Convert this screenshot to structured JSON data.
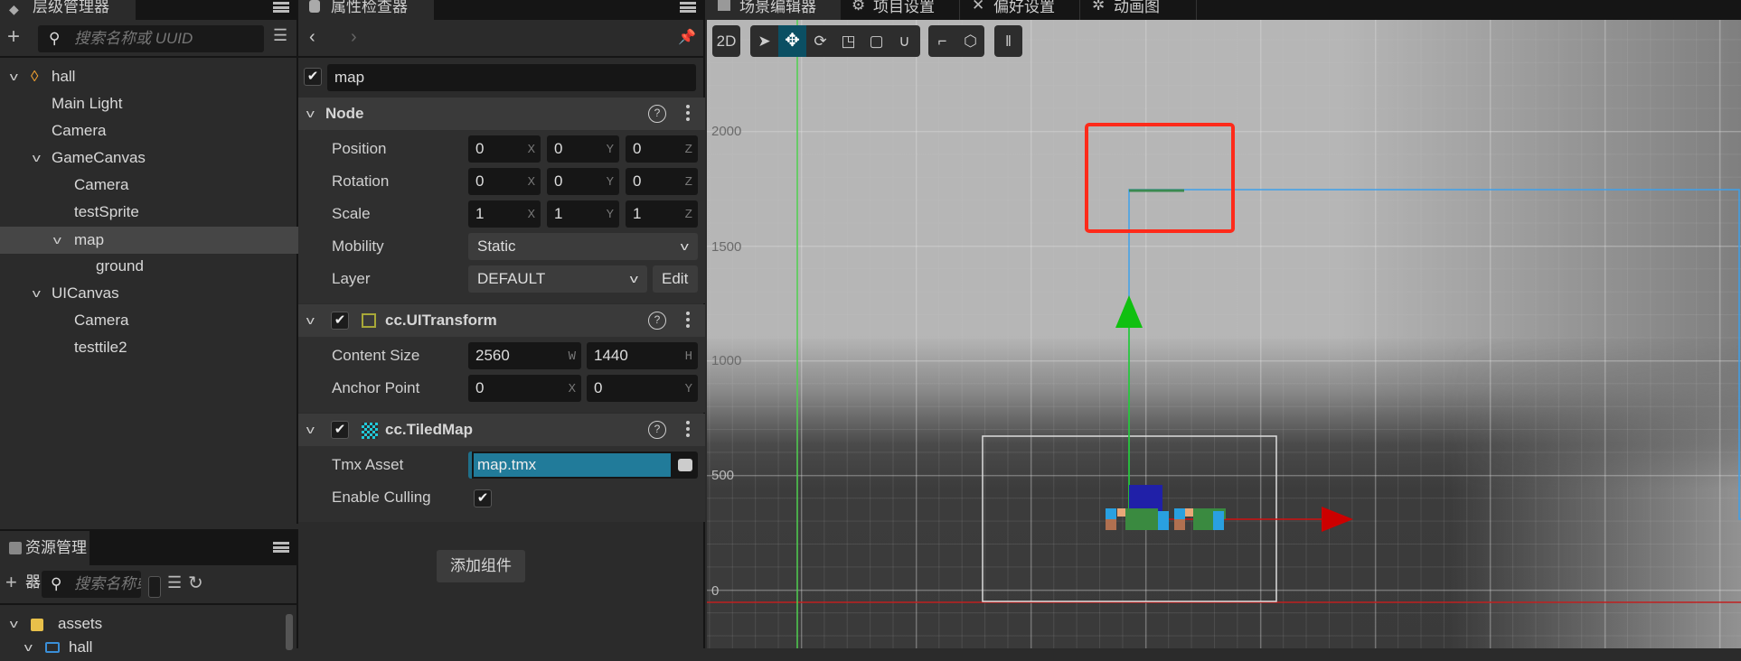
{
  "hierarchy": {
    "title": "层级管理器",
    "search_placeholder": "搜索名称或 UUID",
    "tree": [
      {
        "label": "hall"
      },
      {
        "label": "Main Light"
      },
      {
        "label": "Camera"
      },
      {
        "label": "GameCanvas"
      },
      {
        "label": "Camera"
      },
      {
        "label": "testSprite"
      },
      {
        "label": "map"
      },
      {
        "label": "ground"
      },
      {
        "label": "UICanvas"
      },
      {
        "label": "Camera"
      },
      {
        "label": "testtile2"
      }
    ]
  },
  "assets": {
    "title": "资源管理器",
    "search_placeholder": "搜索名称或 UU",
    "tree": [
      {
        "label": "assets"
      },
      {
        "label": "hall"
      }
    ]
  },
  "inspector": {
    "title": "属性检查器",
    "node_name": "map",
    "node_section": "Node",
    "props": {
      "position": {
        "label": "Position",
        "x": "0",
        "y": "0",
        "z": "0"
      },
      "rotation": {
        "label": "Rotation",
        "x": "0",
        "y": "0",
        "z": "0"
      },
      "scale": {
        "label": "Scale",
        "x": "1",
        "y": "1",
        "z": "1"
      },
      "mobility": {
        "label": "Mobility",
        "value": "Static"
      },
      "layer": {
        "label": "Layer",
        "value": "DEFAULT",
        "edit": "Edit"
      }
    },
    "axes": {
      "x": "X",
      "y": "Y",
      "z": "Z",
      "w": "W",
      "h": "H"
    },
    "uitransform": {
      "title": "cc.UITransform",
      "content_size_label": "Content Size",
      "w": "2560",
      "h": "1440",
      "anchor_label": "Anchor Point",
      "ax": "0",
      "ay": "0"
    },
    "tiledmap": {
      "title": "cc.TiledMap",
      "tmx_label": "Tmx Asset",
      "tmx_value": "map.tmx",
      "culling_label": "Enable Culling",
      "culling": true
    },
    "add_component": "添加组件",
    "help": "?"
  },
  "scene": {
    "tabs": [
      "场景编辑器",
      "项目设置",
      "偏好设置",
      "动画图"
    ],
    "mode_2d": "2D",
    "axis_labels": [
      "2000",
      "1500",
      "1000",
      "500",
      "0"
    ],
    "colors": {
      "accent": "#0b4f63",
      "selection_rect": "#ff2a1a",
      "bounds": "#3ea0ea"
    }
  }
}
